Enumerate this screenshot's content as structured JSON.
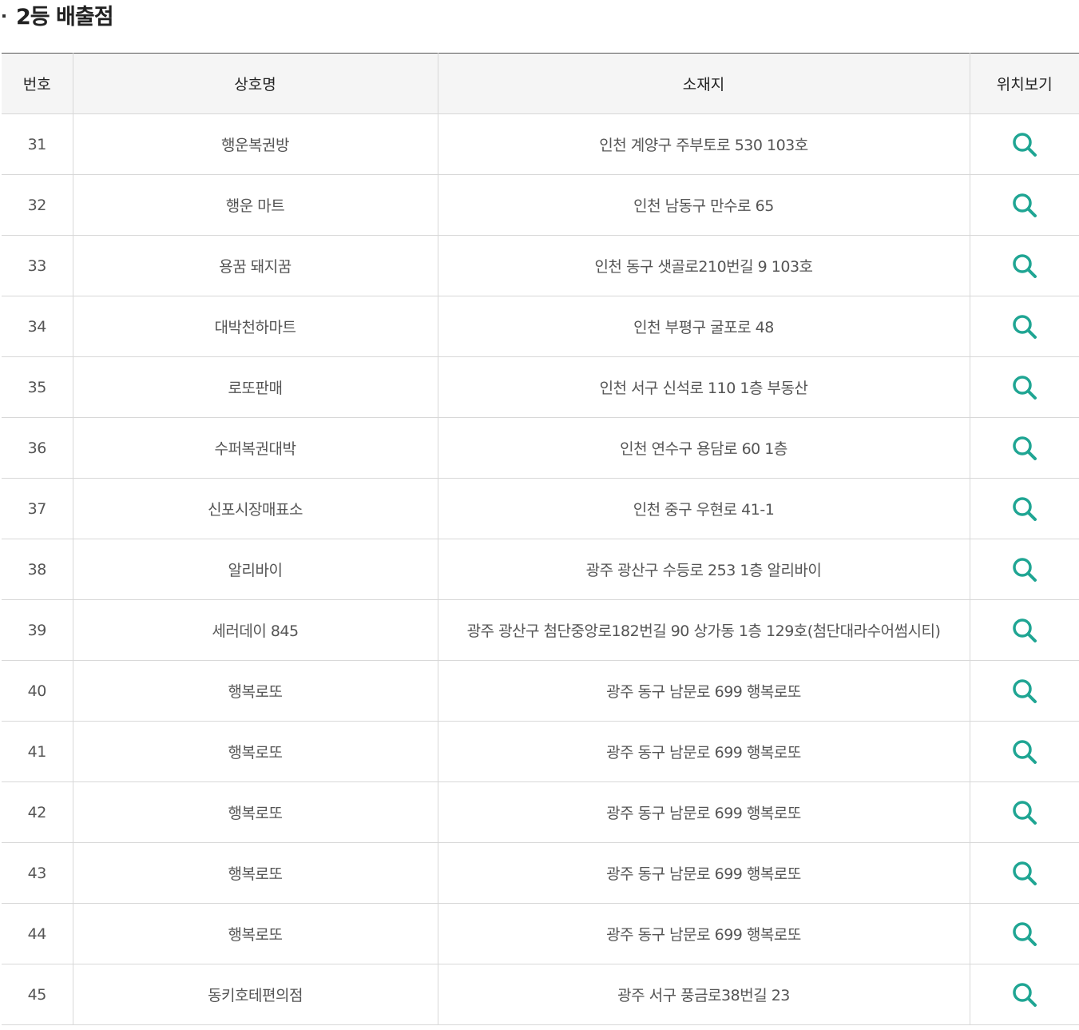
{
  "section_title": "2등 배출점",
  "table": {
    "headers": {
      "number": "번호",
      "store_name": "상호명",
      "address": "소재지",
      "location": "위치보기"
    },
    "rows": [
      {
        "number": "31",
        "store_name": "행운복권방",
        "address": "인천 계양구 주부토로 530 103호"
      },
      {
        "number": "32",
        "store_name": "행운 마트",
        "address": "인천 남동구 만수로 65"
      },
      {
        "number": "33",
        "store_name": "용꿈 돼지꿈",
        "address": "인천 동구 샛골로210번길 9 103호"
      },
      {
        "number": "34",
        "store_name": "대박천하마트",
        "address": "인천 부평구 굴포로 48"
      },
      {
        "number": "35",
        "store_name": "로또판매",
        "address": "인천 서구 신석로 110 1층 부동산"
      },
      {
        "number": "36",
        "store_name": "수퍼복권대박",
        "address": "인천 연수구 용담로 60 1층"
      },
      {
        "number": "37",
        "store_name": "신포시장매표소",
        "address": "인천 중구 우현로 41-1"
      },
      {
        "number": "38",
        "store_name": "알리바이",
        "address": "광주 광산구 수등로 253 1층 알리바이"
      },
      {
        "number": "39",
        "store_name": "세러데이 845",
        "address": "광주 광산구 첨단중앙로182번길 90 상가동 1층 129호(첨단대라수어썸시티)"
      },
      {
        "number": "40",
        "store_name": "행복로또",
        "address": "광주 동구 남문로 699 행복로또"
      },
      {
        "number": "41",
        "store_name": "행복로또",
        "address": "광주 동구 남문로 699 행복로또"
      },
      {
        "number": "42",
        "store_name": "행복로또",
        "address": "광주 동구 남문로 699 행복로또"
      },
      {
        "number": "43",
        "store_name": "행복로또",
        "address": "광주 동구 남문로 699 행복로또"
      },
      {
        "number": "44",
        "store_name": "행복로또",
        "address": "광주 동구 남문로 699 행복로또"
      },
      {
        "number": "45",
        "store_name": "동키호테편의점",
        "address": "광주 서구 풍금로38번길 23"
      }
    ]
  },
  "icons": {
    "location_icon": "search-icon",
    "accent_color": "#1fa593"
  }
}
